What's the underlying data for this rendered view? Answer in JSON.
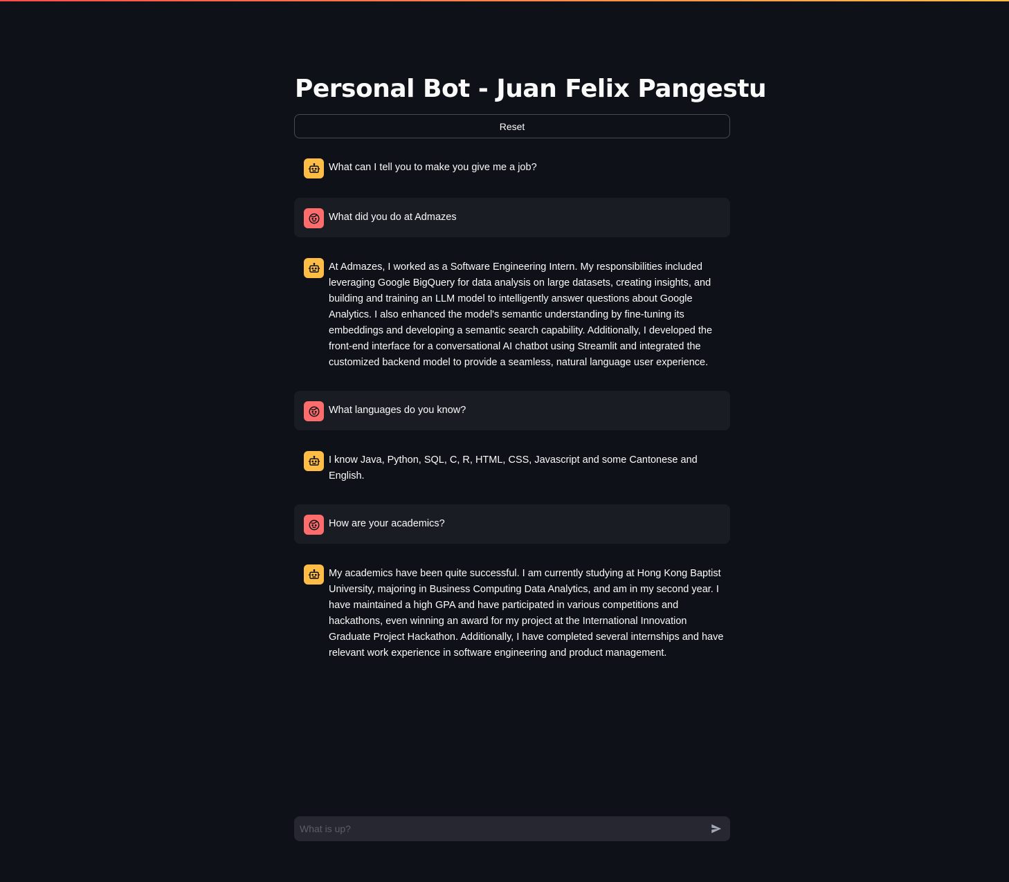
{
  "app": {
    "title": "Personal Bot - Juan Felix Pangestu",
    "accent_gradient": [
      "#ff4b4b",
      "#ffbd45"
    ]
  },
  "toolbar": {
    "reset_label": "Reset"
  },
  "messages": [
    {
      "role": "assistant",
      "avatar_icon": "robot-icon",
      "text": "What can I tell you to make you give me a job?"
    },
    {
      "role": "user",
      "avatar_icon": "user-face-icon",
      "text": "What did you do at Admazes"
    },
    {
      "role": "assistant",
      "avatar_icon": "robot-icon",
      "text": "At Admazes, I worked as a Software Engineering Intern. My responsibilities included leveraging Google BigQuery for data analysis on large datasets, creating insights, and building and training an LLM model to intelligently answer questions about Google Analytics. I also enhanced the model's semantic understanding by fine-tuning its embeddings and developing a semantic search capability. Additionally, I developed the front-end interface for a conversational AI chatbot using Streamlit and integrated the customized backend model to provide a seamless, natural language user experience."
    },
    {
      "role": "user",
      "avatar_icon": "user-face-icon",
      "text": "What languages do you know?"
    },
    {
      "role": "assistant",
      "avatar_icon": "robot-icon",
      "text": "I know Java, Python, SQL, C, R, HTML, CSS, Javascript and some Cantonese and English."
    },
    {
      "role": "user",
      "avatar_icon": "user-face-icon",
      "text": "How are your academics?"
    },
    {
      "role": "assistant",
      "avatar_icon": "robot-icon",
      "text": "My academics have been quite successful. I am currently studying at Hong Kong Baptist University, majoring in Business Computing Data Analytics, and am in my second year. I have maintained a high GPA and have participated in various competitions and hackathons, even winning an award for my project at the International Innovation Graduate Project Hackathon. Additionally, I have completed several internships and have relevant work experience in software engineering and product management."
    }
  ],
  "chat_input": {
    "placeholder": "What is up?",
    "value": "",
    "send_icon": "send-icon"
  },
  "colors": {
    "background": "#0e1117",
    "user_message_bg": "#1a1c24",
    "bot_avatar": "#ffbd45",
    "user_avatar": "#ff6c6c",
    "input_bg": "#262730"
  }
}
